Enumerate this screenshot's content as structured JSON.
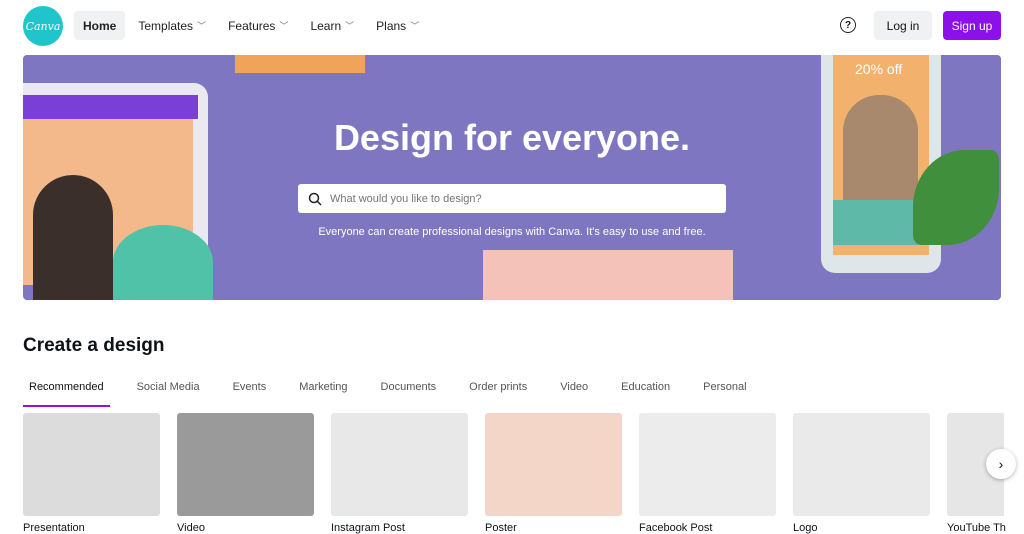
{
  "nav": {
    "logo": "Canva",
    "items": [
      {
        "label": "Home",
        "active": true
      },
      {
        "label": "Templates"
      },
      {
        "label": "Features"
      },
      {
        "label": "Learn"
      },
      {
        "label": "Plans"
      }
    ],
    "help": "?",
    "login": "Log in",
    "signup": "Sign up"
  },
  "hero": {
    "title": "Design for everyone.",
    "search_placeholder": "What would you like to design?",
    "subtitle": "Everyone can create professional designs with Canva. It's easy to use and free.",
    "promo": "20% off"
  },
  "section": {
    "title": "Create a design",
    "tabs": [
      "Recommended",
      "Social Media",
      "Events",
      "Marketing",
      "Documents",
      "Order prints",
      "Video",
      "Education",
      "Personal"
    ],
    "cards": [
      {
        "label": "Presentation",
        "bg": "#dcdcdc"
      },
      {
        "label": "Video",
        "bg": "#9a9a9a"
      },
      {
        "label": "Instagram Post",
        "bg": "#e8e8e8"
      },
      {
        "label": "Poster",
        "bg": "#f3d6c8"
      },
      {
        "label": "Facebook Post",
        "bg": "#ececec"
      },
      {
        "label": "Logo",
        "bg": "#eaeaea"
      },
      {
        "label": "YouTube Th",
        "bg": "#e6e6e6"
      }
    ]
  },
  "colors": {
    "accent": "#8b10ea",
    "logo": "#20c4cb",
    "hero": "#7f76c2"
  }
}
